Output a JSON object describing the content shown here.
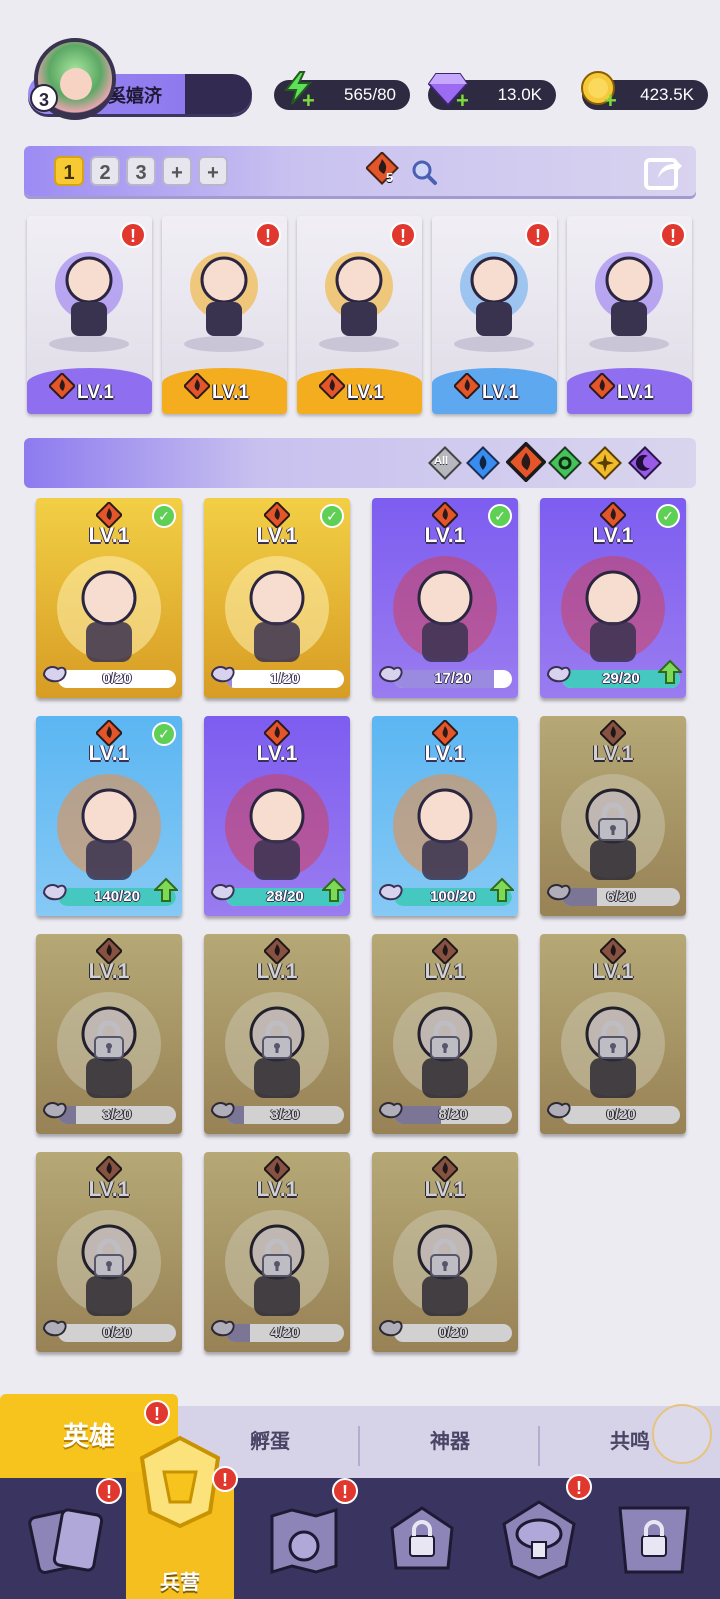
{
  "player": {
    "level": "3",
    "name": "奚嬉济"
  },
  "resources": {
    "energy": "565/80",
    "gems": "13.0K",
    "coins": "423.5K"
  },
  "team_bar": {
    "slots": [
      "1",
      "2",
      "3",
      "+",
      "+"
    ],
    "active_slot": "1",
    "fire_count": "5"
  },
  "team": [
    {
      "level": "LV.1",
      "accent": "#8f6ff0"
    },
    {
      "level": "LV.1",
      "accent": "#f3ad1e"
    },
    {
      "level": "LV.1",
      "accent": "#f3ad1e"
    },
    {
      "level": "LV.1",
      "accent": "#5ea8f0"
    },
    {
      "level": "LV.1",
      "accent": "#8f6ff0"
    }
  ],
  "filters": {
    "all_label": "All",
    "items": [
      "water",
      "fire",
      "nature",
      "light",
      "dark"
    ]
  },
  "heroes": [
    {
      "level": "LV.1",
      "progress": "0/20",
      "fraction": 0,
      "rarity": "gold",
      "checked": true,
      "upgradable": false,
      "locked": false
    },
    {
      "level": "LV.1",
      "progress": "1/20",
      "fraction": 0.05,
      "rarity": "gold",
      "checked": true,
      "upgradable": false,
      "locked": false
    },
    {
      "level": "LV.1",
      "progress": "17/20",
      "fraction": 0.85,
      "rarity": "purple",
      "checked": true,
      "upgradable": false,
      "locked": false
    },
    {
      "level": "LV.1",
      "progress": "29/20",
      "fraction": 1,
      "rarity": "purple",
      "checked": true,
      "upgradable": true,
      "locked": false
    },
    {
      "level": "LV.1",
      "progress": "140/20",
      "fraction": 1,
      "rarity": "blue",
      "checked": true,
      "upgradable": true,
      "locked": false
    },
    {
      "level": "LV.1",
      "progress": "28/20",
      "fraction": 1,
      "rarity": "purple",
      "checked": false,
      "upgradable": true,
      "locked": false
    },
    {
      "level": "LV.1",
      "progress": "100/20",
      "fraction": 1,
      "rarity": "blue",
      "checked": false,
      "upgradable": true,
      "locked": false
    },
    {
      "level": "LV.1",
      "progress": "6/20",
      "fraction": 0.3,
      "rarity": "gold",
      "checked": false,
      "upgradable": false,
      "locked": true
    },
    {
      "level": "LV.1",
      "progress": "3/20",
      "fraction": 0.15,
      "rarity": "gold",
      "checked": false,
      "upgradable": false,
      "locked": true
    },
    {
      "level": "LV.1",
      "progress": "3/20",
      "fraction": 0.15,
      "rarity": "gold",
      "checked": false,
      "upgradable": false,
      "locked": true
    },
    {
      "level": "LV.1",
      "progress": "8/20",
      "fraction": 0.4,
      "rarity": "gold",
      "checked": false,
      "upgradable": false,
      "locked": true
    },
    {
      "level": "LV.1",
      "progress": "0/20",
      "fraction": 0,
      "rarity": "gold",
      "checked": false,
      "upgradable": false,
      "locked": true
    },
    {
      "level": "LV.1",
      "progress": "0/20",
      "fraction": 0,
      "rarity": "gold",
      "checked": false,
      "upgradable": false,
      "locked": true
    },
    {
      "level": "LV.1",
      "progress": "4/20",
      "fraction": 0.2,
      "rarity": "gold",
      "checked": false,
      "upgradable": false,
      "locked": true
    },
    {
      "level": "LV.1",
      "progress": "0/20",
      "fraction": 0,
      "rarity": "gold",
      "checked": false,
      "upgradable": false,
      "locked": true
    }
  ],
  "tabs": [
    {
      "label": "英雄",
      "active": true
    },
    {
      "label": "孵蛋",
      "active": false
    },
    {
      "label": "神器",
      "active": false
    },
    {
      "label": "共鸣",
      "active": false
    }
  ],
  "nav": [
    {
      "label": "",
      "icon": "cards-icon",
      "alert": false
    },
    {
      "label": "兵营",
      "icon": "barracks-icon",
      "alert": true
    },
    {
      "label": "",
      "icon": "map-icon",
      "alert": true
    },
    {
      "label": "",
      "icon": "locked-building-icon",
      "alert": false
    },
    {
      "label": "",
      "icon": "mushroom-icon",
      "alert": true
    },
    {
      "label": "",
      "icon": "locked-gate-icon",
      "alert": false
    }
  ],
  "colors": {
    "accent": "#f7c41e",
    "nav_bg": "#3a3460",
    "alert": "#e0372f"
  }
}
